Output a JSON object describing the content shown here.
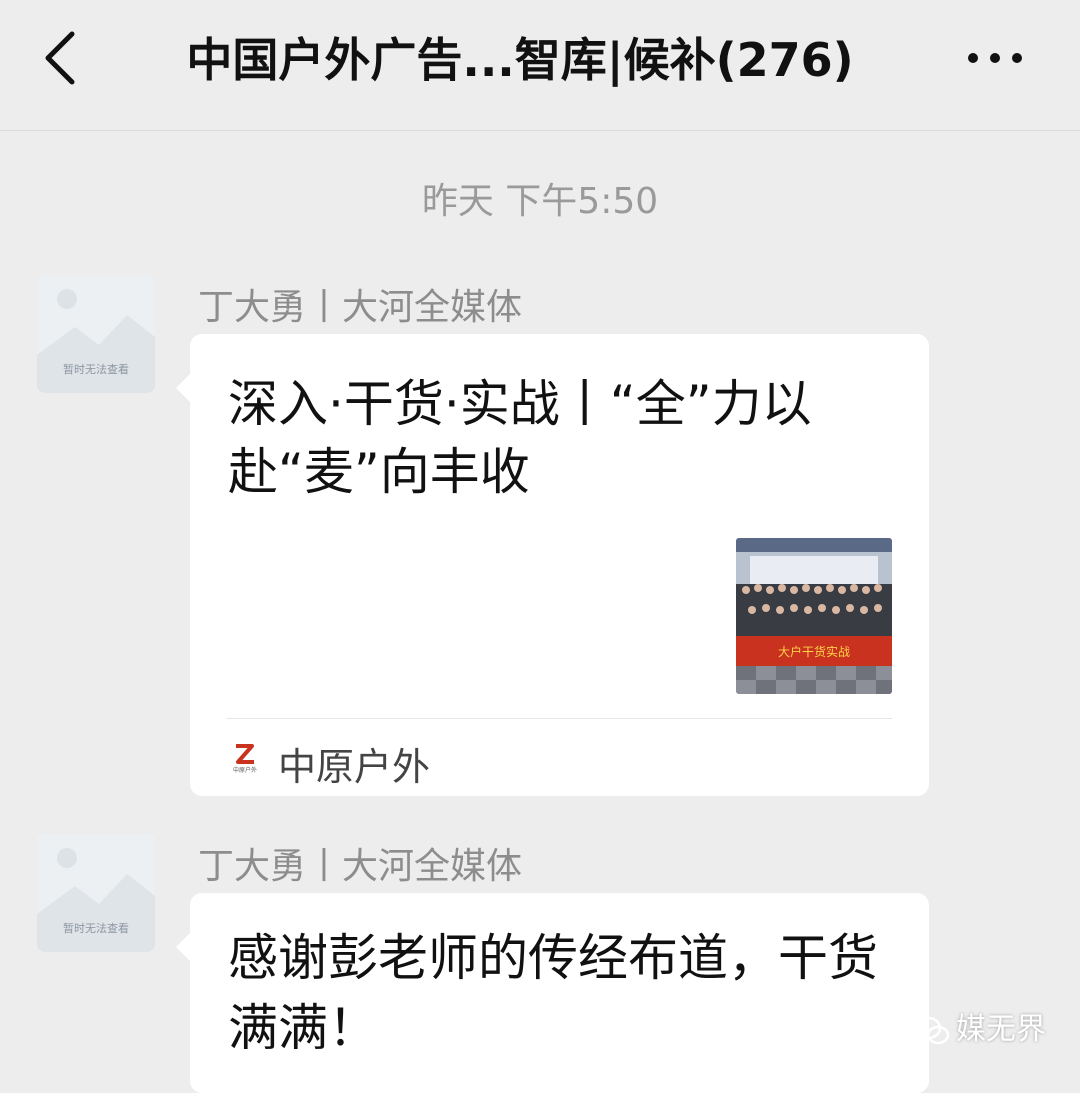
{
  "header": {
    "title": "中国户外广告...智库|候补(276)",
    "back_icon": "chevron-left-icon",
    "more_icon": "more-dots-icon"
  },
  "timestamp": "昨天 下午5:50",
  "messages": [
    {
      "sender": "丁大勇丨大河全媒体",
      "avatar_caption": "暂时无法查看",
      "card": {
        "title": "深入·干货·实战丨“全”力以赴“麦”向丰收",
        "source_name": "中原户外",
        "source_logo_caption": "中原户外",
        "banner_text": "大户干货实战"
      }
    },
    {
      "sender": "丁大勇丨大河全媒体",
      "avatar_caption": "暂时无法查看",
      "text": "感谢彭老师的传经布道，干货满满！"
    }
  ],
  "watermark": "媒无界",
  "colors": {
    "background": "#ededed",
    "bubble": "#ffffff",
    "text": "#111111",
    "muted": "#9a9a9a",
    "banner_red": "#c8321e"
  }
}
